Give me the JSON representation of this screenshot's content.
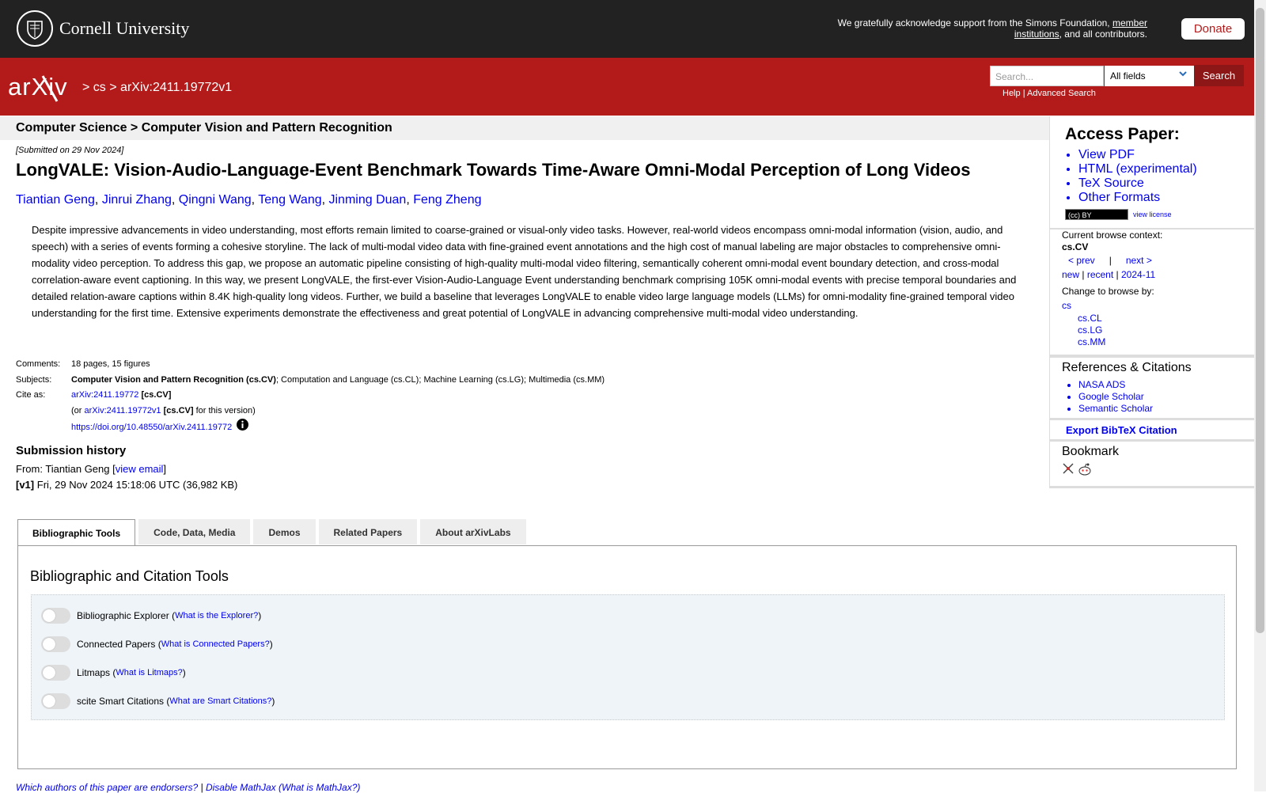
{
  "header": {
    "university": "Cornell University",
    "support_text_1": "We gratefully acknowledge support from the Simons Foundation,",
    "support_link": "member institutions",
    "support_text_2": ", and all contributors.",
    "donate": "Donate"
  },
  "nav": {
    "logo": "arXiv",
    "breadcrumb_sep_1": ">",
    "breadcrumb_cs": "cs",
    "breadcrumb_sep_2": ">",
    "breadcrumb_id": "arXiv:2411.19772v1",
    "search_placeholder": "Search...",
    "search_field": "All fields",
    "search_button": "Search",
    "help": "Help",
    "help_sep": "|",
    "advanced": "Advanced Search"
  },
  "paper": {
    "category_header": "Computer Science > Computer Vision and Pattern Recognition",
    "submitted": "[Submitted on 29 Nov 2024]",
    "title": "LongVALE: Vision-Audio-Language-Event Benchmark Towards Time-Aware Omni-Modal Perception of Long Videos",
    "authors": [
      "Tiantian Geng",
      "Jinrui Zhang",
      "Qingni Wang",
      "Teng Wang",
      "Jinming Duan",
      "Feng Zheng"
    ],
    "author_sep": ", ",
    "abstract": "Despite impressive advancements in video understanding, most efforts remain limited to coarse-grained or visual-only video tasks. However, real-world videos encompass omni-modal information (vision, audio, and speech) with a series of events forming a cohesive storyline. The lack of multi-modal video data with fine-grained event annotations and the high cost of manual labeling are major obstacles to comprehensive omni-modality video perception. To address this gap, we propose an automatic pipeline consisting of high-quality multi-modal video filtering, semantically coherent omni-modal event boundary detection, and cross-modal correlation-aware event captioning. In this way, we present LongVALE, the first-ever Vision-Audio-Language Event understanding benchmark comprising 105K omni-modal events with precise temporal boundaries and detailed relation-aware captions within 8.4K high-quality long videos. Further, we build a baseline that leverages LongVALE to enable video large language models (LLMs) for omni-modality fine-grained temporal video understanding for the first time. Extensive experiments demonstrate the effectiveness and great potential of LongVALE in advancing comprehensive multi-modal video understanding.",
    "comments_label": "Comments:",
    "comments": "18 pages, 15 figures",
    "subjects_label": "Subjects:",
    "subjects_primary": "Computer Vision and Pattern Recognition (cs.CV)",
    "subjects_rest": "; Computation and Language (cs.CL); Machine Learning (cs.LG); Multimedia (cs.MM)",
    "cite_label": "Cite as:",
    "cite_id": "arXiv:2411.19772",
    "cite_cat": "[cs.CV]",
    "cite_or": "(or",
    "cite_version": "arXiv:2411.19772v1",
    "cite_version_cat": "[cs.CV]",
    "cite_version_tail": "for this version)",
    "doi": "https://doi.org/10.48550/arXiv.2411.19772",
    "history_heading": "Submission history",
    "history_from": "From: Tiantian Geng [",
    "history_email": "view email",
    "history_from_close": "]",
    "history_v1_tag": "[v1]",
    "history_v1": "Fri, 29 Nov 2024 15:18:06 UTC (36,982 KB)"
  },
  "sidebar": {
    "access_heading": "Access Paper:",
    "access_links": [
      "View PDF",
      "HTML (experimental)",
      "TeX Source",
      "Other Formats"
    ],
    "license_badge": "(cc) BY",
    "view_license": "view license",
    "browse_context_label": "Current browse context:",
    "browse_context": "cs.CV",
    "prev": "< prev",
    "nav_sep": "|",
    "next": "next >",
    "new": "new",
    "recent": "recent",
    "month": "2024-11",
    "change_browse": "Change to browse by:",
    "browse_cs": "cs",
    "browse_subs": [
      "cs.CL",
      "cs.LG",
      "cs.MM"
    ],
    "refs_heading": "References & Citations",
    "refs_links": [
      "NASA ADS",
      "Google Scholar",
      "Semantic Scholar"
    ],
    "export_bibtex": "Export BibTeX Citation",
    "bookmark_heading": "Bookmark"
  },
  "tabs": {
    "items": [
      "Bibliographic Tools",
      "Code, Data, Media",
      "Demos",
      "Related Papers",
      "About arXivLabs"
    ],
    "active": 0,
    "panel_heading": "Bibliographic and Citation Tools",
    "tools": [
      {
        "label": "Bibliographic Explorer",
        "link": "What is the Explorer?"
      },
      {
        "label": "Connected Papers",
        "link": "What is Connected Papers?"
      },
      {
        "label": "Litmaps",
        "link": "What is Litmaps?"
      },
      {
        "label": "scite Smart Citations",
        "link": "What are Smart Citations?"
      }
    ]
  },
  "footer": {
    "endorsers": "Which authors of this paper are endorsers?",
    "sep": "|",
    "mathjax": "Disable MathJax",
    "mathjax_what": "(What is MathJax?)"
  },
  "colors": {
    "arxiv_red": "#b31b1b",
    "header_dark": "#222222",
    "link_blue": "#0000ee"
  }
}
